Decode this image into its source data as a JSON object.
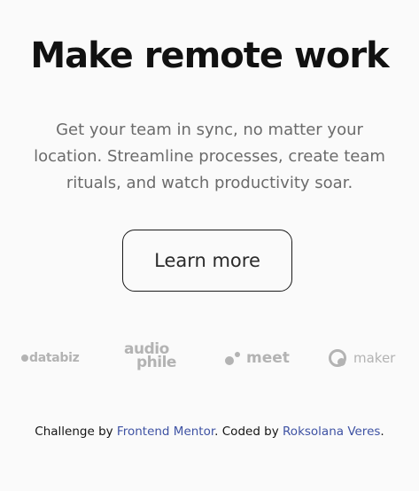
{
  "hero": {
    "title": "Make remote work",
    "description": "Get your team in sync, no matter your location. Streamline processes, create team rituals, and watch productivity soar.",
    "cta_label": "Learn more"
  },
  "clients": {
    "logos": [
      {
        "name": "databiz",
        "text": "databiz"
      },
      {
        "name": "audiophile",
        "text_top": "audio",
        "text_bottom": "phile"
      },
      {
        "name": "meet",
        "text": "meet"
      },
      {
        "name": "maker",
        "text": "maker"
      }
    ]
  },
  "footer": {
    "prefix": "Challenge by ",
    "challenge_link": "Frontend Mentor",
    "middle": ". Coded by ",
    "author_link": "Roksolana Veres",
    "suffix": "."
  },
  "colors": {
    "background": "#fafafa",
    "title": "#111111",
    "body_text": "#6b6b6b",
    "logo_gray": "#b3b3b3",
    "link": "#3e52a3"
  }
}
